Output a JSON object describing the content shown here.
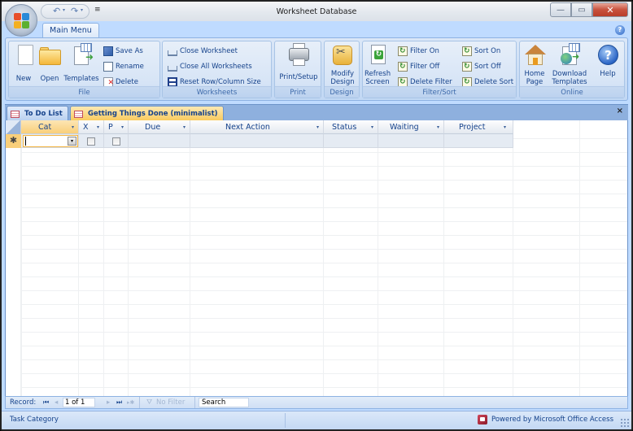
{
  "window": {
    "title": "Worksheet Database",
    "controls": {
      "minimize": "—",
      "maximize": "▭",
      "close": "✕"
    }
  },
  "qat": {
    "undo": "↶",
    "redo": "↷",
    "customize": "₹"
  },
  "ribbon": {
    "tabs": [
      {
        "label": "Main Menu",
        "active": true
      }
    ],
    "help_glyph": "?",
    "groups": {
      "file": {
        "label": "File",
        "big": [
          {
            "label": "New",
            "icon": "new-document-icon"
          },
          {
            "label": "Open",
            "icon": "open-folder-icon"
          },
          {
            "label": "Templates",
            "icon": "templates-icon"
          }
        ],
        "small": [
          {
            "label": "Save As",
            "icon": "save-as-icon"
          },
          {
            "label": "Rename",
            "icon": "rename-icon"
          },
          {
            "label": "Delete",
            "icon": "delete-icon"
          }
        ]
      },
      "worksheets": {
        "label": "Worksheets",
        "small": [
          {
            "label": "Close Worksheet",
            "icon": "close-worksheet-icon"
          },
          {
            "label": "Close All Worksheets",
            "icon": "close-all-worksheets-icon"
          },
          {
            "label": "Reset Row/Column Size",
            "icon": "reset-size-icon"
          }
        ]
      },
      "print": {
        "label": "Print",
        "big": [
          {
            "label": "Print/Setup",
            "icon": "printer-icon"
          }
        ]
      },
      "design": {
        "label": "Design",
        "big": [
          {
            "label_line1": "Modify",
            "label_line2": "Design",
            "icon": "modify-design-icon"
          }
        ]
      },
      "filter_sort": {
        "label": "Filter/Sort",
        "big": [
          {
            "label_line1": "Refresh",
            "label_line2": "Screen",
            "icon": "refresh-icon"
          }
        ],
        "small": [
          {
            "label": "Filter On"
          },
          {
            "label": "Filter Off"
          },
          {
            "label": "Delete Filter"
          },
          {
            "label": "Sort On"
          },
          {
            "label": "Sort Off"
          },
          {
            "label": "Delete Sort"
          }
        ]
      },
      "online": {
        "label": "Online",
        "big": [
          {
            "label_line1": "Home",
            "label_line2": "Page",
            "icon": "home-icon"
          },
          {
            "label_line1": "Download",
            "label_line2": "Templates",
            "icon": "download-templates-icon"
          },
          {
            "label_line1": "Help",
            "label_line2": "",
            "icon": "help-icon",
            "glyph": "?"
          }
        ]
      }
    }
  },
  "doc_tabs": [
    {
      "label": "To Do List",
      "active": false
    },
    {
      "label": "Getting Things Done (minimalist)",
      "active": true
    }
  ],
  "doc_close": "×",
  "grid": {
    "columns": [
      {
        "label": "Cat",
        "selected": true
      },
      {
        "label": "X"
      },
      {
        "label": "P"
      },
      {
        "label": "Due"
      },
      {
        "label": "Next Action"
      },
      {
        "label": "Status"
      },
      {
        "label": "Waiting"
      },
      {
        "label": "Project"
      }
    ],
    "dropdown_arrow": "▾",
    "new_row_marker": "✱",
    "new_row": {
      "cat": "",
      "x": false,
      "p": false,
      "due": "",
      "next_action": "",
      "status": "",
      "waiting": "",
      "project": ""
    }
  },
  "record_nav": {
    "label": "Record:",
    "first": "⏮",
    "prev": "◂",
    "current": "1 of 1",
    "next": "▸",
    "last": "⏭",
    "new": "▸✱",
    "filter_label": "No Filter",
    "search_label": "Search"
  },
  "status_bar": {
    "left": "Task Category",
    "right": "Powered by Microsoft Office Access"
  }
}
